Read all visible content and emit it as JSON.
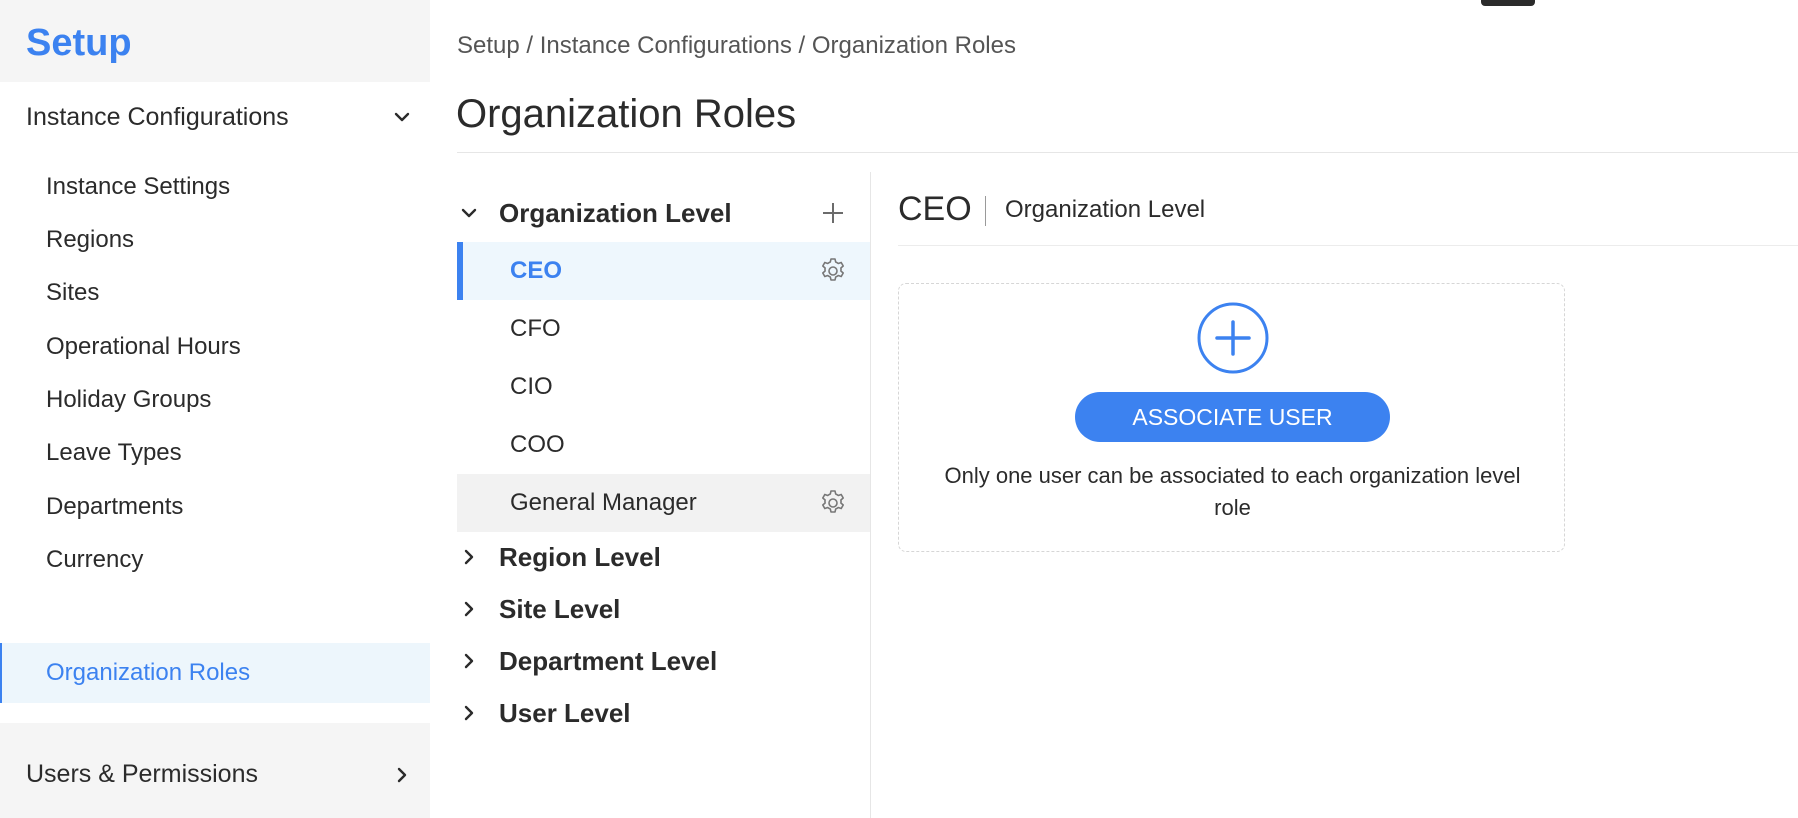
{
  "sidebar": {
    "title": "Setup",
    "sections": [
      {
        "label": "Instance Configurations",
        "expanded": true,
        "icon": "chevron-down-icon",
        "items": [
          {
            "label": "Instance Settings"
          },
          {
            "label": "Regions"
          },
          {
            "label": "Sites"
          },
          {
            "label": "Operational Hours"
          },
          {
            "label": "Holiday Groups"
          },
          {
            "label": "Leave Types"
          },
          {
            "label": "Departments"
          },
          {
            "label": "Currency"
          },
          {
            "label": "Organization Roles",
            "active": true
          }
        ]
      },
      {
        "label": "Users & Permissions",
        "expanded": false,
        "icon": "chevron-right-icon"
      }
    ]
  },
  "header": {
    "breadcrumb": "Setup / Instance Configurations / Organization Roles",
    "title": "Organization Roles"
  },
  "tree": {
    "levels": [
      {
        "label": "Organization Level",
        "expanded": true,
        "roles": [
          {
            "label": "CEO",
            "selected": true
          },
          {
            "label": "CFO"
          },
          {
            "label": "CIO"
          },
          {
            "label": "COO"
          },
          {
            "label": "General Manager",
            "hovered": true
          }
        ]
      },
      {
        "label": "Region Level",
        "expanded": false
      },
      {
        "label": "Site Level",
        "expanded": false
      },
      {
        "label": "Department Level",
        "expanded": false
      },
      {
        "label": "User Level",
        "expanded": false
      }
    ]
  },
  "detail": {
    "role": "CEO",
    "level": "Organization Level",
    "associate_button": "ASSOCIATE USER",
    "note": "Only one user can be associated to each organization level role"
  },
  "colors": {
    "accent": "#3c82f0",
    "sidebar_bg": "#f5f5f5",
    "selected_bg": "#eef7fd",
    "text": "#2b2b2b"
  }
}
